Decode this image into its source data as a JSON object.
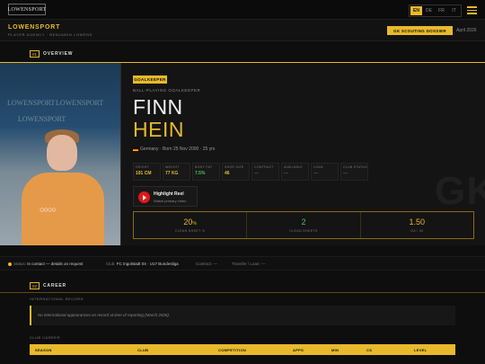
{
  "topbar": {
    "logo": "LOWENSPORT",
    "languages": [
      {
        "code": "EN",
        "active": true
      },
      {
        "code": "DE",
        "active": false
      },
      {
        "code": "FR",
        "active": false
      },
      {
        "code": "IT",
        "active": false
      }
    ],
    "menu_icon": "hamburger-menu-icon"
  },
  "agency": {
    "brand": "LOWENSPORT",
    "subtitle": "PLAYER AGENCY · BENJAMIN LOWENS",
    "dossier_button": "GK SCOUTING DOSSIER",
    "date": "April 2026"
  },
  "overview": {
    "num": "01",
    "title": "OVERVIEW"
  },
  "player": {
    "position_badge": "GOALKEEPER",
    "role": "BALL-PLAYING GOALKEEPER",
    "first_name": "FINN",
    "last_name": "HEIN",
    "bio": "Germany · Born 25 Nov 2000 · 25 yrs",
    "photo_watermark": "LOWENSPORT",
    "big_tag": "GK",
    "stats": [
      {
        "key": "HEIGHT",
        "value": "191 CM",
        "style": "gold"
      },
      {
        "key": "WEIGHT",
        "value": "77 KG",
        "style": "gold"
      },
      {
        "key": "BODY FAT",
        "value": "7.5%",
        "style": "green"
      },
      {
        "key": "SHOE SIZE",
        "value": "46",
        "style": "gold"
      },
      {
        "key": "CONTRACT",
        "value": "—",
        "style": "muted"
      },
      {
        "key": "AVAILABLE",
        "value": "—",
        "style": "muted"
      },
      {
        "key": "LOAN",
        "value": "—",
        "style": "muted"
      },
      {
        "key": "CLUB STATUS",
        "value": "—",
        "style": "muted"
      }
    ],
    "highlight": {
      "title": "Highlight Reel",
      "subtitle": "Watch primary video"
    },
    "kpis": [
      {
        "value": "20",
        "suffix": "%",
        "label": "CLEAN SHEET %",
        "style": "gold"
      },
      {
        "value": "2",
        "label": "CLEAN SHEETS",
        "style": "green"
      },
      {
        "value": "1.50",
        "label": "GA / 90",
        "style": "gold"
      }
    ]
  },
  "status": {
    "status_label": "Status:",
    "status_value": "In contact — details on request",
    "club_label": "Club:",
    "club_value": "FC Ingolstadt 04 · U17 Bundesliga",
    "contract_label": "Contract:",
    "contract_value": "—",
    "transfer_label": "Transfer / Loan:",
    "transfer_value": "—"
  },
  "career": {
    "num": "02",
    "title": "CAREER",
    "intl_label": "INTERNATIONAL RECORD",
    "intl_notice": "No international appearances on record at time of reporting (March 2026).",
    "club_label": "CLUB CAREER",
    "columns": [
      "SEASON",
      "CLUB",
      "COMPETITION",
      "APPS",
      "MIN",
      "CS",
      "LEVEL"
    ]
  }
}
